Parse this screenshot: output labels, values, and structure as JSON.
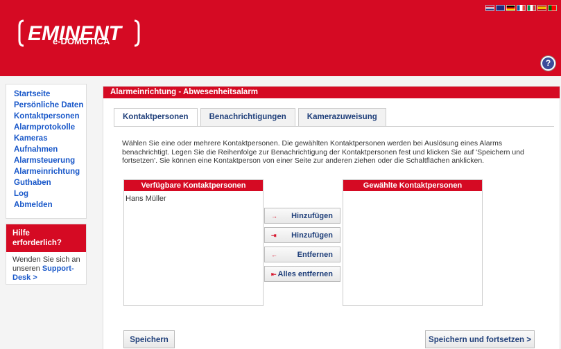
{
  "header": {
    "brand": "EMINENT",
    "product": "e-DOMOTICA",
    "help_icon": "?",
    "flags": [
      "#1f4fa3",
      "#1f2b7a",
      "#d1a52a",
      "#3a6ab7",
      "#2f9a3c",
      "#f0c020",
      "#c23a2a"
    ]
  },
  "sidebar": {
    "items": [
      "Startseite",
      "Persönliche Daten",
      "Kontaktpersonen",
      "Alarmprotokolle",
      "Kameras",
      "Aufnahmen",
      "Alarmsteuerung",
      "Alarmeinrichtung",
      "Guthaben",
      "Log",
      "Abmelden"
    ]
  },
  "help": {
    "title_line1": "Hilfe",
    "title_line2": "erforderlich?",
    "text": "Wenden Sie sich an unseren ",
    "link_line1": "Support-",
    "link_line2": "Desk >"
  },
  "panel": {
    "title": "Alarmeinrichtung - Abwesenheitsalarm",
    "tabs": [
      "Kontaktpersonen",
      "Benachrichtigungen",
      "Kamerazuweisung"
    ],
    "description": "Wählen Sie eine oder mehrere Kontaktpersonen. Die gewählten Kontaktpersonen werden bei Auslösung eines Alarms benachrichtigt. Legen Sie die Reihenfolge zur Benachrichtigung der Kontaktpersonen fest und klicken Sie auf 'Speichern und fortsetzen'. Sie können eine Kontaktperson von einer Seite zur anderen ziehen oder die Schaltflächen anklicken.",
    "available_title": "Verfügbare Kontaktpersonen",
    "available_items": [
      "Hans Müller"
    ],
    "selected_title": "Gewählte Kontaktpersonen",
    "buttons": [
      {
        "arrow": "→",
        "label": "Hinzufügen"
      },
      {
        "arrow": "⇥",
        "label": "Hinzufügen"
      },
      {
        "arrow": "←",
        "label": "Entfernen"
      },
      {
        "arrow": "⇤",
        "label": "Alles entfernen"
      }
    ],
    "save_label": "Speichern",
    "save_continue_label": "Speichern und fortsetzen >"
  }
}
